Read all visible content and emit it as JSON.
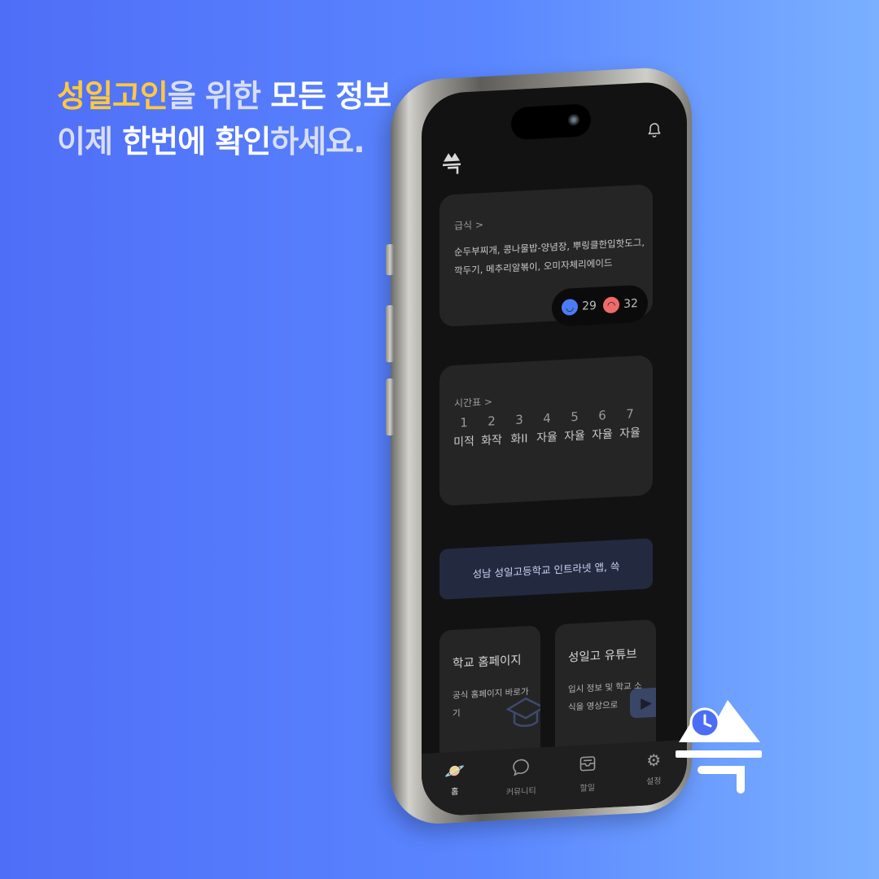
{
  "headline": {
    "line1": [
      {
        "text": "성일고인",
        "color": "yellow"
      },
      {
        "text": "을 위한 ",
        "color": "gray"
      },
      {
        "text": "모든 정보",
        "color": "white"
      }
    ],
    "line2": [
      {
        "text": "이제 ",
        "color": "gray"
      },
      {
        "text": "한번에 확인",
        "color": "white"
      },
      {
        "text": "하세요.",
        "color": "gray"
      }
    ]
  },
  "colors": {
    "yellow": "#ffc93c",
    "accent_blue": "#4b7cf5",
    "angry_red": "#ef6a6a",
    "background": "#5a7df9"
  },
  "status_bar": {
    "bell_icon": "bell-icon"
  },
  "meal": {
    "title": "급식 >",
    "menu": "순두부찌개, 콩나물밥-양념장, 뿌링클한입핫도그, 깍두기, 메추리알볶이, 오미자체리에이드",
    "likes": "29",
    "dislikes": "32"
  },
  "timetable": {
    "title": "시간표 >",
    "periods": [
      {
        "num": "1",
        "subject": "미적"
      },
      {
        "num": "2",
        "subject": "화작"
      },
      {
        "num": "3",
        "subject": "화II"
      },
      {
        "num": "4",
        "subject": "자율"
      },
      {
        "num": "5",
        "subject": "자율"
      },
      {
        "num": "6",
        "subject": "자율"
      },
      {
        "num": "7",
        "subject": "자율"
      }
    ]
  },
  "banner": {
    "text": "성남 성일고등학교 인트라넷 앱, 쓱"
  },
  "tiles": {
    "homepage": {
      "title": "학교 홈페이지",
      "desc": "공식 홈페이지 바로가기"
    },
    "youtube": {
      "title": "성일고 유튜브",
      "desc": "입시 정보 및 학교 소식을 영상으로"
    }
  },
  "tabbar": [
    {
      "label": "홈",
      "icon": "planet-icon",
      "active": true
    },
    {
      "label": "커뮤니티",
      "icon": "chat-bubble-icon",
      "active": false
    },
    {
      "label": "할일",
      "icon": "inbox-tray-icon",
      "active": false
    },
    {
      "label": "설정",
      "icon": "gear-icon",
      "active": false
    }
  ]
}
